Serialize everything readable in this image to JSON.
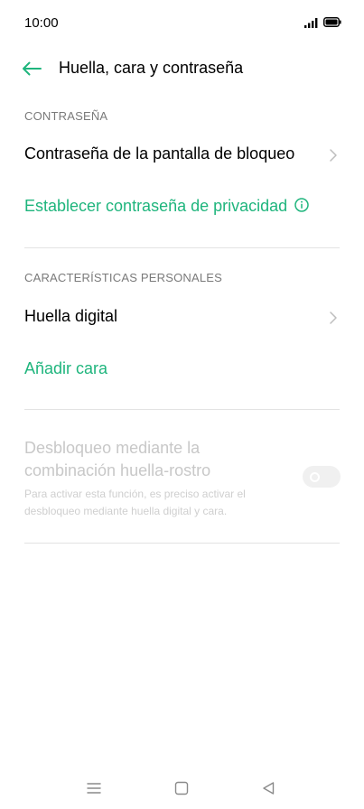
{
  "status_bar": {
    "time": "10:00"
  },
  "header": {
    "title": "Huella, cara y contraseña"
  },
  "sections": {
    "password": {
      "label": "CONTRASEÑA",
      "lock_screen_password": "Contraseña de la pantalla de bloqueo",
      "privacy_password": "Establecer contraseña de privacidad"
    },
    "personal": {
      "label": "CARACTERÍSTICAS PERSONALES",
      "fingerprint": "Huella digital",
      "add_face": "Añadir cara"
    },
    "combo_unlock": {
      "title": "Desbloqueo mediante la combinación huella-rostro",
      "description": "Para activar esta función, es preciso activar el desbloqueo mediante huella digital y cara.",
      "enabled": false
    }
  },
  "colors": {
    "accent": "#1fb57d",
    "text": "#000000",
    "muted": "#7a7a7a",
    "disabled": "#c8c8c8",
    "divider": "#e3e3e3"
  },
  "icons": {
    "back": "arrow-left-icon",
    "chevron": "chevron-right-icon",
    "info": "info-icon",
    "signal": "signal-icon",
    "battery": "battery-icon",
    "nav_menu": "menu-icon",
    "nav_home": "home-icon",
    "nav_back": "back-triangle-icon"
  }
}
